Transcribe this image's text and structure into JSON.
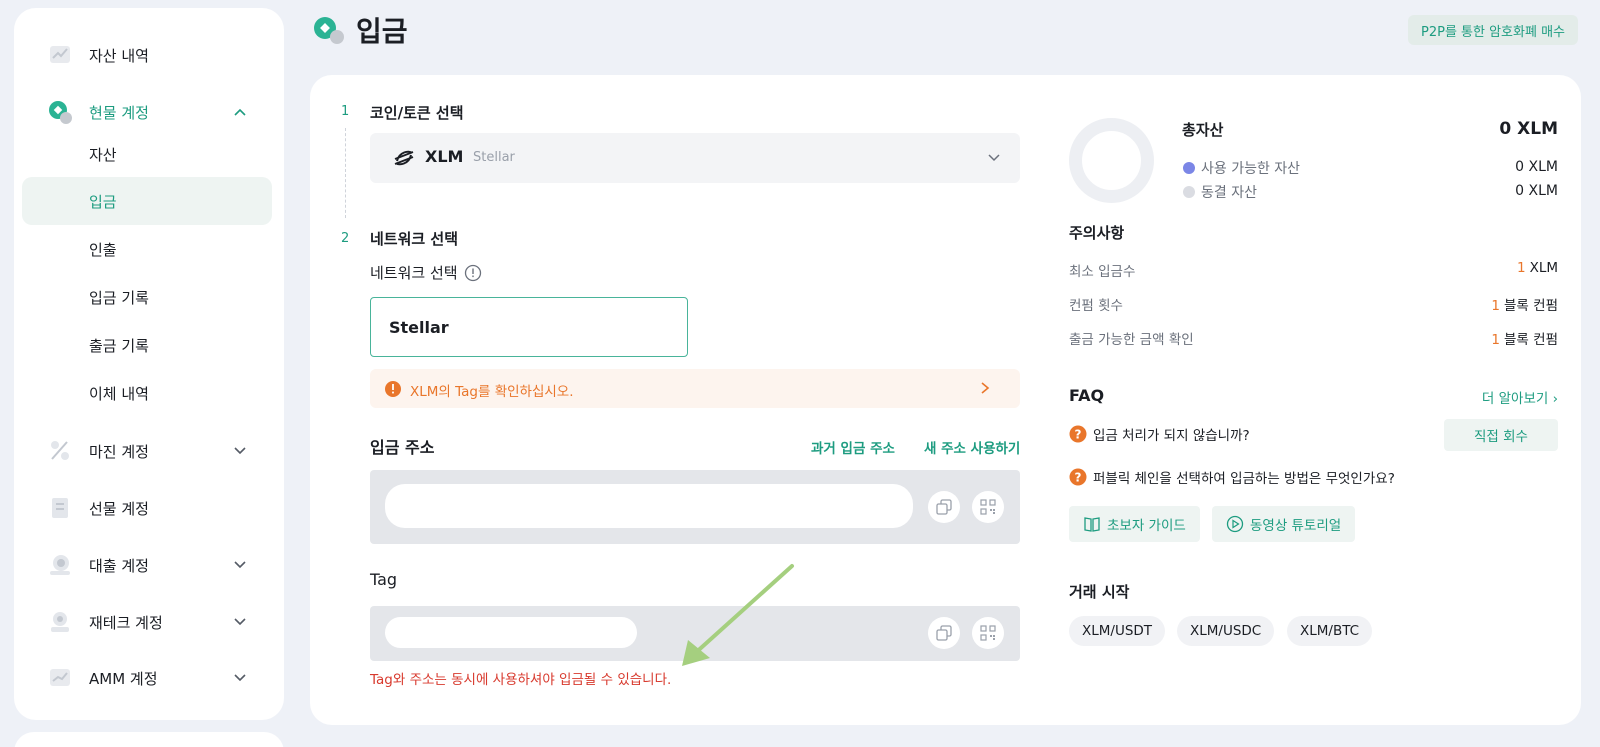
{
  "sidebar": {
    "items": [
      {
        "label": "자산 내역",
        "icon": "chart-icon"
      },
      {
        "label": "현물 계정",
        "icon": "spot-account-icon"
      },
      {
        "label": "마진 계정",
        "icon": "margin-icon"
      },
      {
        "label": "선물 계정",
        "icon": "futures-icon"
      },
      {
        "label": "대출 계정",
        "icon": "loan-icon"
      },
      {
        "label": "재테크 계정",
        "icon": "earn-icon"
      },
      {
        "label": "AMM 계정",
        "icon": "amm-icon"
      }
    ],
    "sub_items": [
      "자산",
      "입금",
      "인출",
      "입금 기록",
      "출금 기록",
      "이체 내역"
    ]
  },
  "header": {
    "title": "입금",
    "p2p_label": "P2P를 통한 암호화폐 매수"
  },
  "steps": {
    "step1": {
      "num": "1",
      "title": "코인/토큰 선택"
    },
    "step2": {
      "num": "2",
      "title": "네트워크 선택"
    }
  },
  "coin": {
    "symbol": "XLM",
    "name": "Stellar"
  },
  "network": {
    "label": "네트워크 선택",
    "value": "Stellar"
  },
  "warning": {
    "text": "XLM의 Tag를 확인하십시오."
  },
  "address": {
    "title": "입금 주소",
    "past_label": "과거 입금 주소",
    "new_label": "새 주소 사용하기"
  },
  "tag": {
    "title": "Tag",
    "warning": "Tag와 주소는 동시에 사용하셔야 입금될 수 있습니다."
  },
  "assets": {
    "total_label": "총자산",
    "total_value": "0 XLM",
    "available_label": "사용 가능한 자산",
    "available_value": "0 XLM",
    "frozen_label": "동결 자산",
    "frozen_value": "0 XLM",
    "available_color": "#7b86e6",
    "frozen_color": "#dadce2"
  },
  "notes": {
    "title": "주의사항",
    "rows": [
      {
        "label": "최소 입금수",
        "highlight": "1",
        "value": "XLM"
      },
      {
        "label": "컨펌 횟수",
        "highlight": "1",
        "value": "블록 컨펌"
      },
      {
        "label": "출금 가능한 금액 확인",
        "highlight": "1",
        "value": "블록 컨펌"
      }
    ]
  },
  "faq": {
    "title": "FAQ",
    "more": "더 알아보기 ›",
    "q1": "입금 처리가 되지 않습니까?",
    "recover": "직접 회수",
    "q2": "퍼블릭 체인을 선택하여 입금하는 방법은 무엇인가요?",
    "guide": "초보자 가이드",
    "video": "동영상 튜토리얼"
  },
  "trade": {
    "title": "거래 시작",
    "pairs": [
      "XLM/USDT",
      "XLM/USDC",
      "XLM/BTC"
    ]
  },
  "colors": {
    "accent": "#1d9c80",
    "warning": "#e9762b",
    "error": "#d83a2e"
  }
}
